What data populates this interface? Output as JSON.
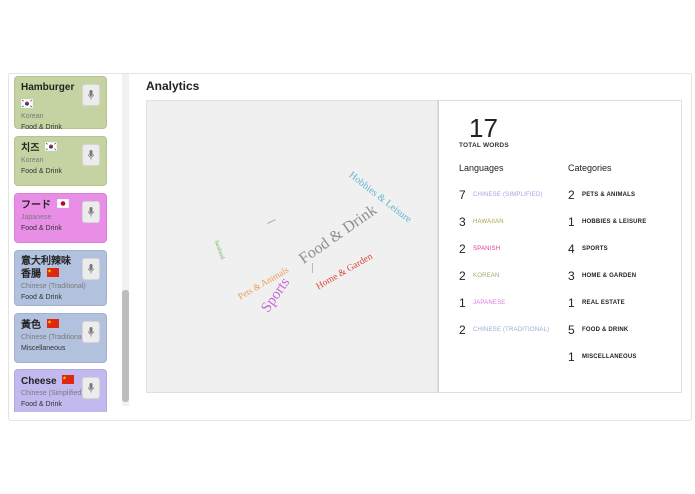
{
  "analytics": {
    "title": "Analytics"
  },
  "words": [
    {
      "word": "Hamburger",
      "language": "Korean",
      "category": "Food & Drink",
      "flag": "kr-flag",
      "color": "#c5d3a3"
    },
    {
      "word": "치즈",
      "language": "Korean",
      "category": "Food & Drink",
      "flag": "kr-flag",
      "color": "#c5d3a3"
    },
    {
      "word": "フード",
      "language": "Japanese",
      "category": "Food & Drink",
      "flag": "jp-flag",
      "color": "#e88ee6"
    },
    {
      "word": "意大利辣味香腸",
      "language": "Chinese (Traditional)",
      "category": "Food & Drink",
      "flag": "cn-flag",
      "color": "#b2c1de"
    },
    {
      "word": "黃色",
      "language": "Chinese (Traditional)",
      "category": "Miscellaneous",
      "flag": "cn-flag",
      "color": "#b2c1de"
    },
    {
      "word": "Cheese",
      "language": "Chinese (Simplified)",
      "category": "Food & Drink",
      "flag": "cn-flag",
      "color": "#c2b9ee"
    }
  ],
  "cloud": [
    {
      "text": "Food & Drink",
      "color": "#8f8f8f"
    },
    {
      "text": "Hobbies & Leisure",
      "color": "#5fb6c9"
    },
    {
      "text": "Pets & Animals",
      "color": "#e89a52"
    },
    {
      "text": "Sports",
      "color": "#c46ad6"
    },
    {
      "text": "Home & Garden",
      "color": "#d9473e"
    },
    {
      "text": "Seafood",
      "color": "#6bb35a"
    }
  ],
  "stats": {
    "total": "17",
    "total_label": "TOTAL WORDS",
    "languages_heading": "Languages",
    "categories_heading": "Categories",
    "languages": [
      {
        "count": "7",
        "label": "CHINESE (SIMPLIFIED)",
        "color": "#a99ee8"
      },
      {
        "count": "3",
        "label": "HAWAIIAN",
        "color": "#a8a845"
      },
      {
        "count": "2",
        "label": "SPANISH",
        "color": "#e0389a"
      },
      {
        "count": "2",
        "label": "KOREAN",
        "color": "#9aae6a"
      },
      {
        "count": "1",
        "label": "JAPANESE",
        "color": "#d77be0"
      },
      {
        "count": "2",
        "label": "CHINESE (TRADITIONAL)",
        "color": "#98acd6"
      }
    ],
    "categories": [
      {
        "count": "2",
        "label": "PETS & ANIMALS"
      },
      {
        "count": "1",
        "label": "HOBBIES & LEISURE"
      },
      {
        "count": "4",
        "label": "SPORTS"
      },
      {
        "count": "3",
        "label": "HOME & GARDEN"
      },
      {
        "count": "1",
        "label": "REAL ESTATE"
      },
      {
        "count": "5",
        "label": "FOOD & DRINK"
      },
      {
        "count": "1",
        "label": "MISCELLANEOUS"
      }
    ]
  }
}
